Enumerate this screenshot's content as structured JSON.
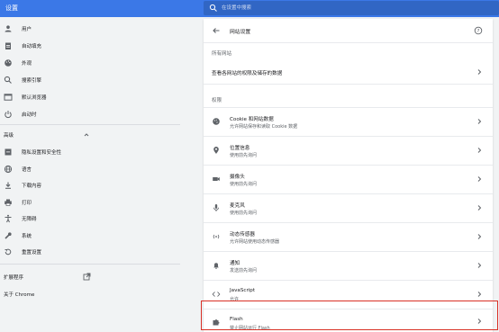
{
  "app": {
    "title": "设置"
  },
  "search": {
    "placeholder": "在设置中搜索"
  },
  "sidebar": {
    "items": [
      {
        "label": "用户",
        "icon": "person-icon"
      },
      {
        "label": "自动填充",
        "icon": "clipboard-icon"
      },
      {
        "label": "外观",
        "icon": "palette-icon"
      },
      {
        "label": "搜索引擎",
        "icon": "search-icon"
      },
      {
        "label": "默认浏览器",
        "icon": "browser-icon"
      },
      {
        "label": "启动时",
        "icon": "power-icon"
      }
    ],
    "advanced_label": "高级",
    "advanced_items": [
      {
        "label": "隐私设置和安全性",
        "icon": "shield-icon"
      },
      {
        "label": "语言",
        "icon": "globe-icon"
      },
      {
        "label": "下载内容",
        "icon": "download-icon"
      },
      {
        "label": "打印",
        "icon": "print-icon"
      },
      {
        "label": "无障碍",
        "icon": "accessibility-icon"
      },
      {
        "label": "系统",
        "icon": "wrench-icon"
      },
      {
        "label": "重置设置",
        "icon": "restore-icon"
      }
    ],
    "extensions_label": "扩展程序",
    "about_label": "关于 Chrome"
  },
  "main": {
    "title": "网站设置",
    "all_sites_label": "所有网站",
    "all_sites_link": "查看各网站的权限及储存的数据",
    "permissions_label": "权限",
    "rows": [
      {
        "title": "Cookie 和网站数据",
        "subtitle": "允许网站保存和读取 Cookie 数据",
        "icon": "cookie-icon"
      },
      {
        "title": "位置信息",
        "subtitle": "使用前先询问",
        "icon": "location-pin-icon"
      },
      {
        "title": "摄像头",
        "subtitle": "使用前先询问",
        "icon": "camera-icon"
      },
      {
        "title": "麦克风",
        "subtitle": "使用前先询问",
        "icon": "microphone-icon"
      },
      {
        "title": "动态传感器",
        "subtitle": "允许网站使用动态传感器",
        "icon": "sensor-icon"
      },
      {
        "title": "通知",
        "subtitle": "发送前先询问",
        "icon": "bell-icon"
      },
      {
        "title": "JavaScript",
        "subtitle": "允许",
        "icon": "code-icon"
      },
      {
        "title": "Flash",
        "subtitle": "禁止网站运行 Flash",
        "icon": "puzzle-icon"
      }
    ]
  },
  "colors": {
    "topbar": "#3b78e7",
    "highlight": "#d93025",
    "background": "#f1f3f4"
  }
}
